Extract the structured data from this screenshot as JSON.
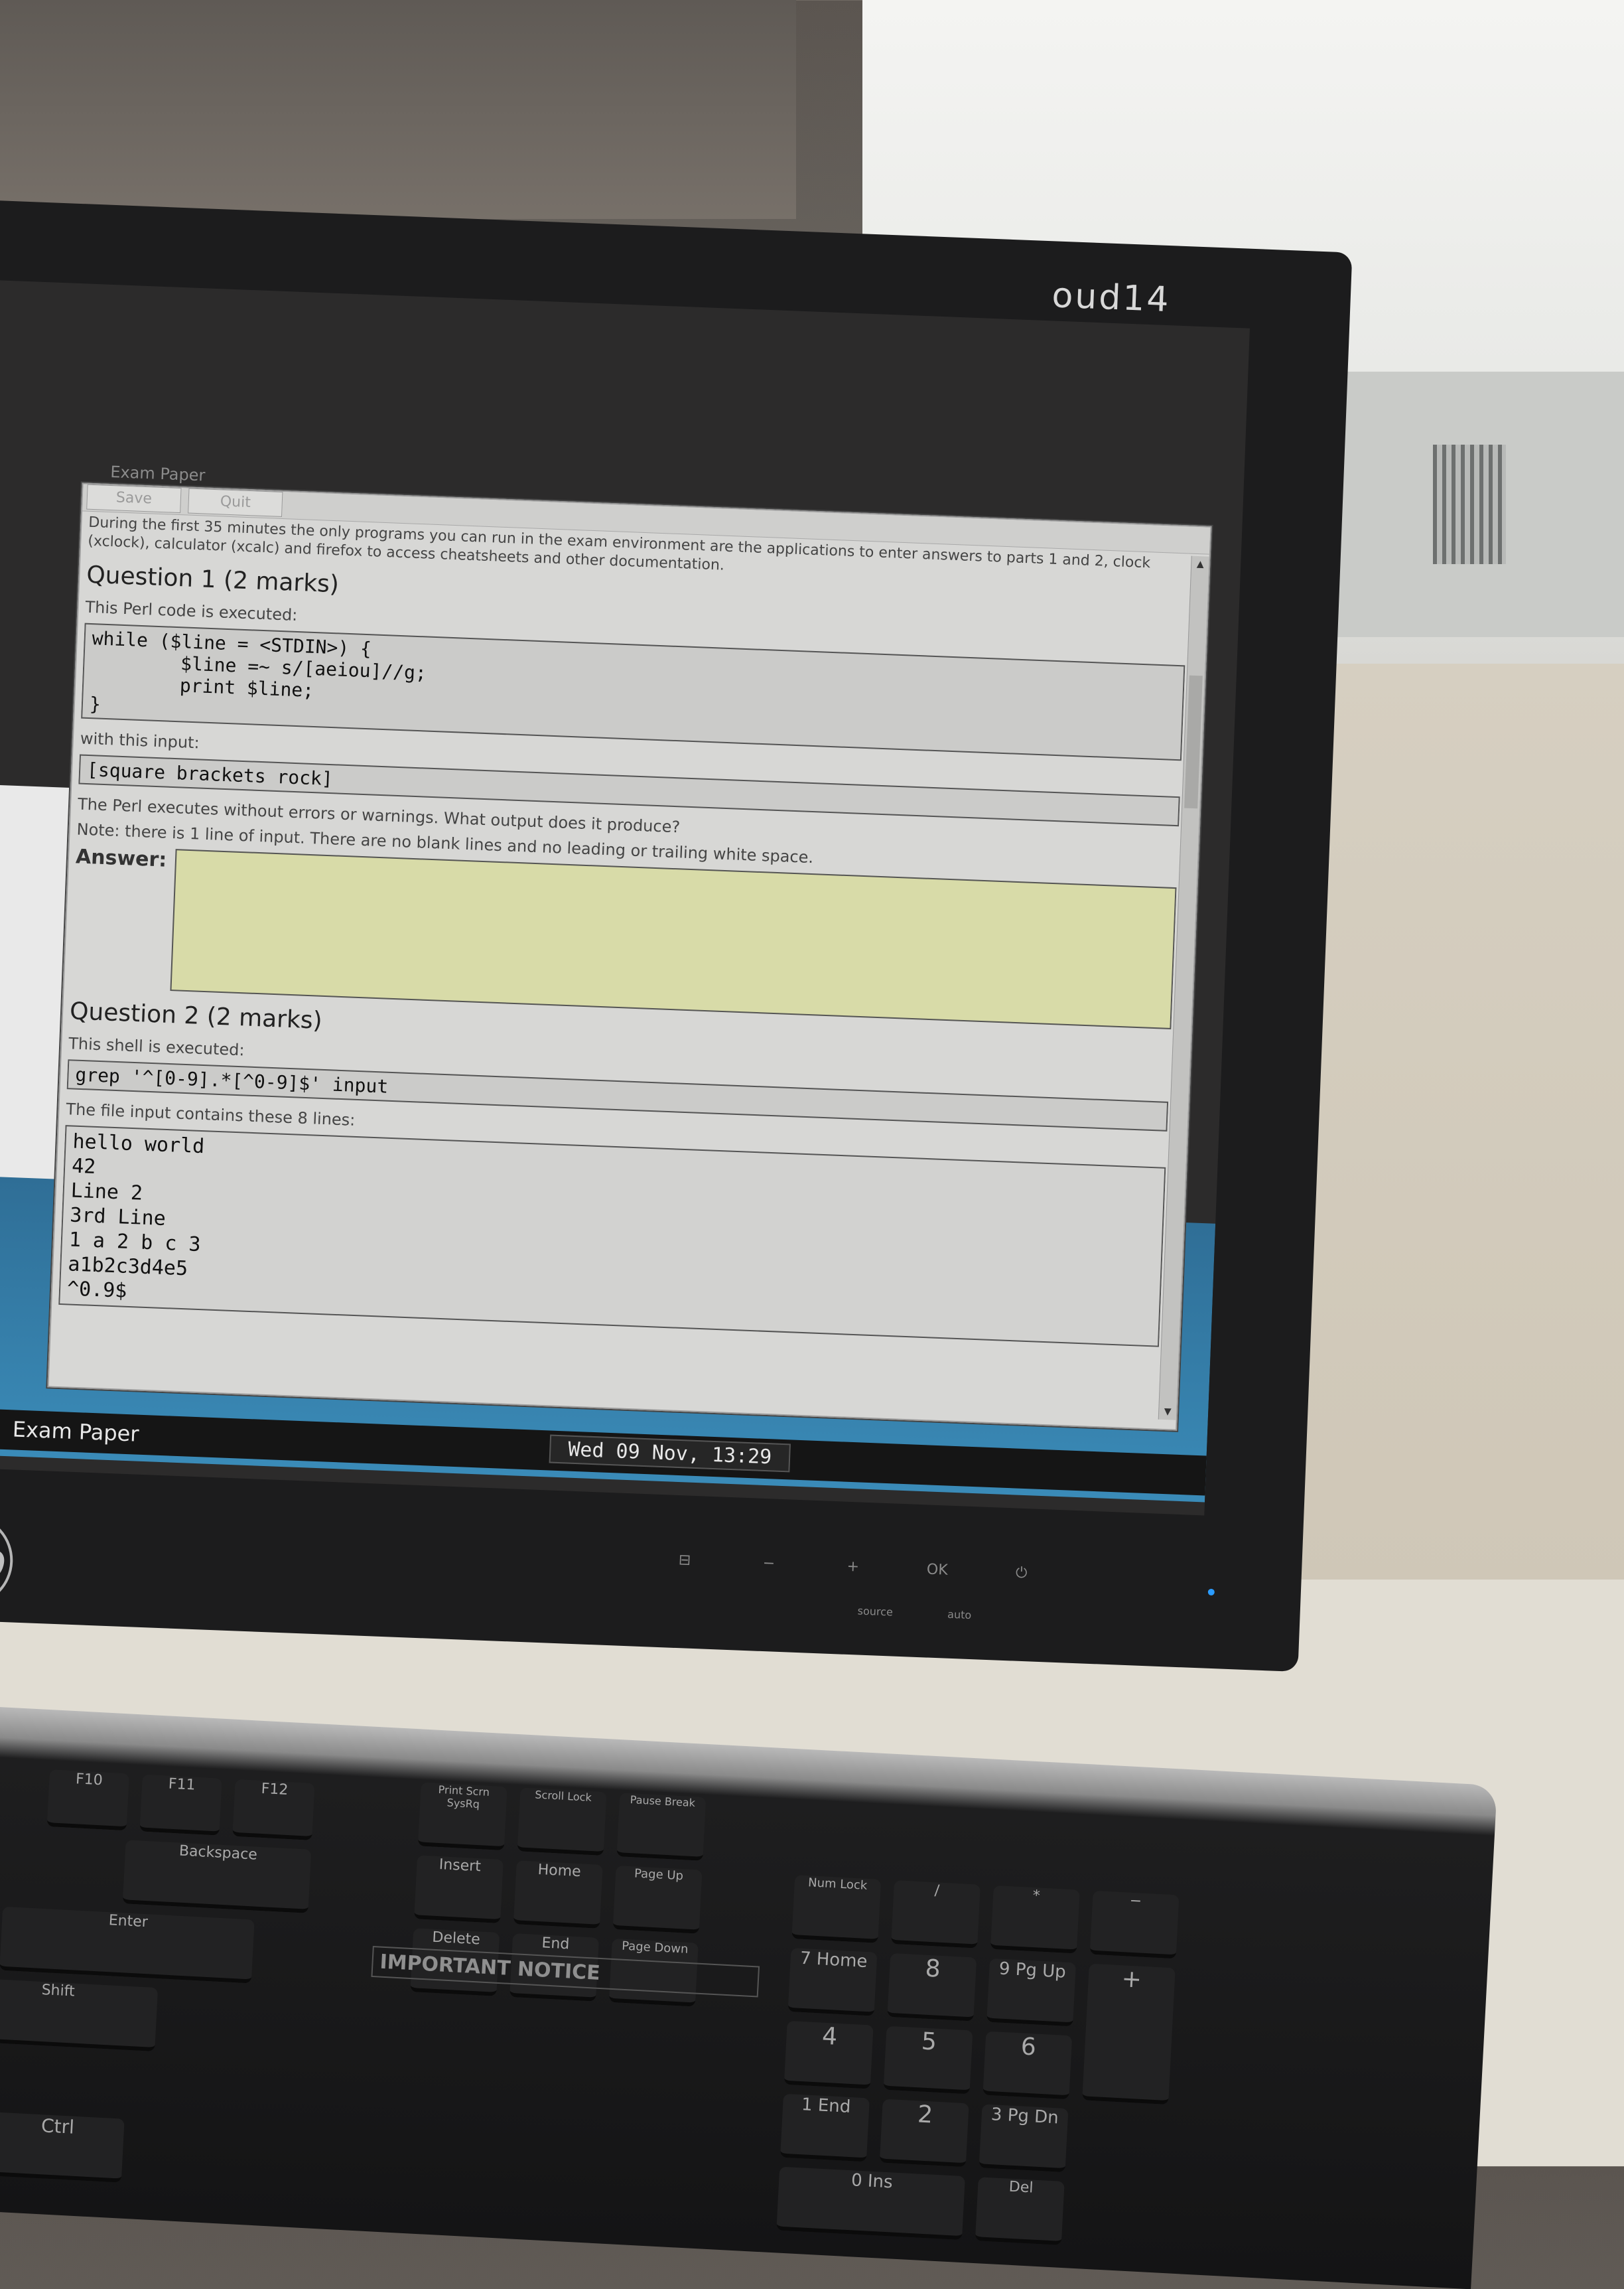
{
  "monitor": {
    "asset_label": "oud14",
    "brand": "hp",
    "controls": [
      "⊟",
      "−",
      "+",
      "OK",
      "⏻"
    ],
    "control_sublabels": [
      "source",
      "auto"
    ]
  },
  "window": {
    "title": "Exam Paper",
    "buttons": [
      "Save",
      "Quit"
    ],
    "intro": "During the first 35 minutes the only programs you can run in the exam environment are the applications to enter answers to parts 1 and 2, clock (xclock), calculator (xcalc) and firefox to access cheatsheets and other documentation."
  },
  "q1": {
    "title": "Question 1 (2 marks)",
    "code_label": "This Perl code is executed:",
    "code": "while ($line = <STDIN>) {\n        $line =~ s/[aeiou]//g;\n        print $line;\n}",
    "input_label": "with this input:",
    "input": "[square brackets rock]",
    "question": "The Perl executes without errors or warnings. What output does it produce?",
    "note": "Note: there is 1 line of input.  There are no blank lines and no leading or trailing white space.",
    "answer_label": "Answer:",
    "answer_value": ""
  },
  "q2": {
    "title": "Question 2 (2 marks)",
    "code_label": "This shell is executed:",
    "code": "grep '^[0-9].*[^0-9]$' input",
    "file_label": "The file input contains these 8 lines:",
    "lines": [
      "hello world",
      "42",
      "Line 2",
      "3rd Line",
      "1 a 2 b c 3",
      "a1b2c3d4e5",
      "^0.9$"
    ]
  },
  "taskbar": {
    "active_window": "Exam Paper",
    "clock": "Wed 09 Nov, 13:29"
  },
  "keyboard": {
    "notice": "IMPORTANT NOTICE",
    "keys": [
      "F10",
      "F11",
      "F12",
      "Print Scrn SysRq",
      "Scroll Lock",
      "Pause Break",
      "Backspace",
      "Insert",
      "Home",
      "Page Up",
      "Num Lock",
      "/",
      "*",
      "−",
      "Delete",
      "End",
      "Page Down",
      "7 Home",
      "8",
      "9 Pg Up",
      "+",
      "Enter",
      "4",
      "5",
      "6",
      "1 End",
      "2",
      "3 Pg Dn",
      "0 Ins",
      "Del",
      "Shift",
      "Ctrl"
    ]
  }
}
